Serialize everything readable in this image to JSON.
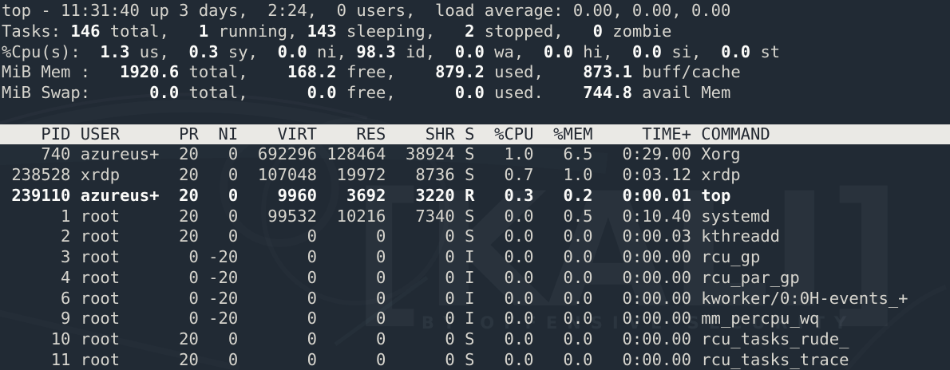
{
  "colors": {
    "background": "#212a34",
    "foreground": "#d7d5ce",
    "bold_foreground": "#fbfbf9",
    "header_bg": "#eae9e5",
    "header_fg": "#222831"
  },
  "watermark": {
    "brand": "[KALI]",
    "tagline": "BY OFFENSIVE SECURITY"
  },
  "summary_lines": [
    {
      "name": "uptime-line",
      "segments": [
        {
          "t": "top - 11:31:40 up 3 days,  2:24,  0 users,  load average: 0.00, 0.00, 0.00",
          "b": false
        }
      ]
    },
    {
      "name": "tasks-line",
      "segments": [
        {
          "t": "Tasks: ",
          "b": false
        },
        {
          "t": "146",
          "b": true
        },
        {
          "t": " total,   ",
          "b": false
        },
        {
          "t": "1",
          "b": true
        },
        {
          "t": " running, ",
          "b": false
        },
        {
          "t": "143",
          "b": true
        },
        {
          "t": " sleeping,   ",
          "b": false
        },
        {
          "t": "2",
          "b": true
        },
        {
          "t": " stopped,   ",
          "b": false
        },
        {
          "t": "0",
          "b": true
        },
        {
          "t": " zombie",
          "b": false
        }
      ]
    },
    {
      "name": "cpu-line",
      "segments": [
        {
          "t": "%Cpu(s):  ",
          "b": false
        },
        {
          "t": "1.3",
          "b": true
        },
        {
          "t": " us,  ",
          "b": false
        },
        {
          "t": "0.3",
          "b": true
        },
        {
          "t": " sy,  ",
          "b": false
        },
        {
          "t": "0.0",
          "b": true
        },
        {
          "t": " ni, ",
          "b": false
        },
        {
          "t": "98.3",
          "b": true
        },
        {
          "t": " id,  ",
          "b": false
        },
        {
          "t": "0.0",
          "b": true
        },
        {
          "t": " wa,  ",
          "b": false
        },
        {
          "t": "0.0",
          "b": true
        },
        {
          "t": " hi,  ",
          "b": false
        },
        {
          "t": "0.0",
          "b": true
        },
        {
          "t": " si,  ",
          "b": false
        },
        {
          "t": "0.0",
          "b": true
        },
        {
          "t": " st",
          "b": false
        }
      ]
    },
    {
      "name": "mem-line",
      "segments": [
        {
          "t": "MiB Mem :   ",
          "b": false
        },
        {
          "t": "1920.6",
          "b": true
        },
        {
          "t": " total,    ",
          "b": false
        },
        {
          "t": "168.2",
          "b": true
        },
        {
          "t": " free,    ",
          "b": false
        },
        {
          "t": "879.2",
          "b": true
        },
        {
          "t": " used,    ",
          "b": false
        },
        {
          "t": "873.1",
          "b": true
        },
        {
          "t": " buff/cache",
          "b": false
        }
      ]
    },
    {
      "name": "swap-line",
      "segments": [
        {
          "t": "MiB Swap:      ",
          "b": false
        },
        {
          "t": "0.0",
          "b": true
        },
        {
          "t": " total,      ",
          "b": false
        },
        {
          "t": "0.0",
          "b": true
        },
        {
          "t": " free,      ",
          "b": false
        },
        {
          "t": "0.0",
          "b": true
        },
        {
          "t": " used.    ",
          "b": false
        },
        {
          "t": "744.8",
          "b": true
        },
        {
          "t": " avail Mem",
          "b": false
        }
      ]
    }
  ],
  "process_table": {
    "columns": [
      {
        "label": "PID",
        "key": "pid",
        "width": 7,
        "align": "right"
      },
      {
        "label": "USER",
        "key": "user",
        "width": 8,
        "align": "left"
      },
      {
        "label": "PR",
        "key": "pr",
        "width": 3,
        "align": "right"
      },
      {
        "label": "NI",
        "key": "ni",
        "width": 3,
        "align": "right"
      },
      {
        "label": "VIRT",
        "key": "virt",
        "width": 7,
        "align": "right"
      },
      {
        "label": "RES",
        "key": "res",
        "width": 6,
        "align": "right"
      },
      {
        "label": "SHR",
        "key": "shr",
        "width": 6,
        "align": "right"
      },
      {
        "label": "S",
        "key": "s",
        "width": 1,
        "align": "left"
      },
      {
        "label": "%CPU",
        "key": "cpu",
        "width": 5,
        "align": "right"
      },
      {
        "label": "%MEM",
        "key": "mem",
        "width": 5,
        "align": "right"
      },
      {
        "label": "TIME+",
        "key": "time",
        "width": 9,
        "align": "right"
      },
      {
        "label": "COMMAND",
        "key": "command",
        "width": 0,
        "align": "left"
      }
    ],
    "rows": [
      {
        "pid": "740",
        "user": "azureus+",
        "pr": "20",
        "ni": "0",
        "virt": "692296",
        "res": "128464",
        "shr": "38924",
        "s": "S",
        "cpu": "1.0",
        "mem": "6.5",
        "time": "0:29.00",
        "command": "Xorg",
        "bold": false
      },
      {
        "pid": "238528",
        "user": "xrdp",
        "pr": "20",
        "ni": "0",
        "virt": "107048",
        "res": "19972",
        "shr": "8736",
        "s": "S",
        "cpu": "0.7",
        "mem": "1.0",
        "time": "0:03.12",
        "command": "xrdp",
        "bold": false
      },
      {
        "pid": "239110",
        "user": "azureus+",
        "pr": "20",
        "ni": "0",
        "virt": "9960",
        "res": "3692",
        "shr": "3220",
        "s": "R",
        "cpu": "0.3",
        "mem": "0.2",
        "time": "0:00.01",
        "command": "top",
        "bold": true
      },
      {
        "pid": "1",
        "user": "root",
        "pr": "20",
        "ni": "0",
        "virt": "99532",
        "res": "10216",
        "shr": "7340",
        "s": "S",
        "cpu": "0.0",
        "mem": "0.5",
        "time": "0:10.40",
        "command": "systemd",
        "bold": false
      },
      {
        "pid": "2",
        "user": "root",
        "pr": "20",
        "ni": "0",
        "virt": "0",
        "res": "0",
        "shr": "0",
        "s": "S",
        "cpu": "0.0",
        "mem": "0.0",
        "time": "0:00.03",
        "command": "kthreadd",
        "bold": false
      },
      {
        "pid": "3",
        "user": "root",
        "pr": "0",
        "ni": "-20",
        "virt": "0",
        "res": "0",
        "shr": "0",
        "s": "I",
        "cpu": "0.0",
        "mem": "0.0",
        "time": "0:00.00",
        "command": "rcu_gp",
        "bold": false
      },
      {
        "pid": "4",
        "user": "root",
        "pr": "0",
        "ni": "-20",
        "virt": "0",
        "res": "0",
        "shr": "0",
        "s": "I",
        "cpu": "0.0",
        "mem": "0.0",
        "time": "0:00.00",
        "command": "rcu_par_gp",
        "bold": false
      },
      {
        "pid": "6",
        "user": "root",
        "pr": "0",
        "ni": "-20",
        "virt": "0",
        "res": "0",
        "shr": "0",
        "s": "I",
        "cpu": "0.0",
        "mem": "0.0",
        "time": "0:00.00",
        "command": "kworker/0:0H-events_+",
        "bold": false
      },
      {
        "pid": "9",
        "user": "root",
        "pr": "0",
        "ni": "-20",
        "virt": "0",
        "res": "0",
        "shr": "0",
        "s": "I",
        "cpu": "0.0",
        "mem": "0.0",
        "time": "0:00.00",
        "command": "mm_percpu_wq",
        "bold": false
      },
      {
        "pid": "10",
        "user": "root",
        "pr": "20",
        "ni": "0",
        "virt": "0",
        "res": "0",
        "shr": "0",
        "s": "S",
        "cpu": "0.0",
        "mem": "0.0",
        "time": "0:00.00",
        "command": "rcu_tasks_rude_",
        "bold": false
      },
      {
        "pid": "11",
        "user": "root",
        "pr": "20",
        "ni": "0",
        "virt": "0",
        "res": "0",
        "shr": "0",
        "s": "S",
        "cpu": "0.0",
        "mem": "0.0",
        "time": "0:00.00",
        "command": "rcu_tasks_trace",
        "bold": false
      }
    ]
  }
}
